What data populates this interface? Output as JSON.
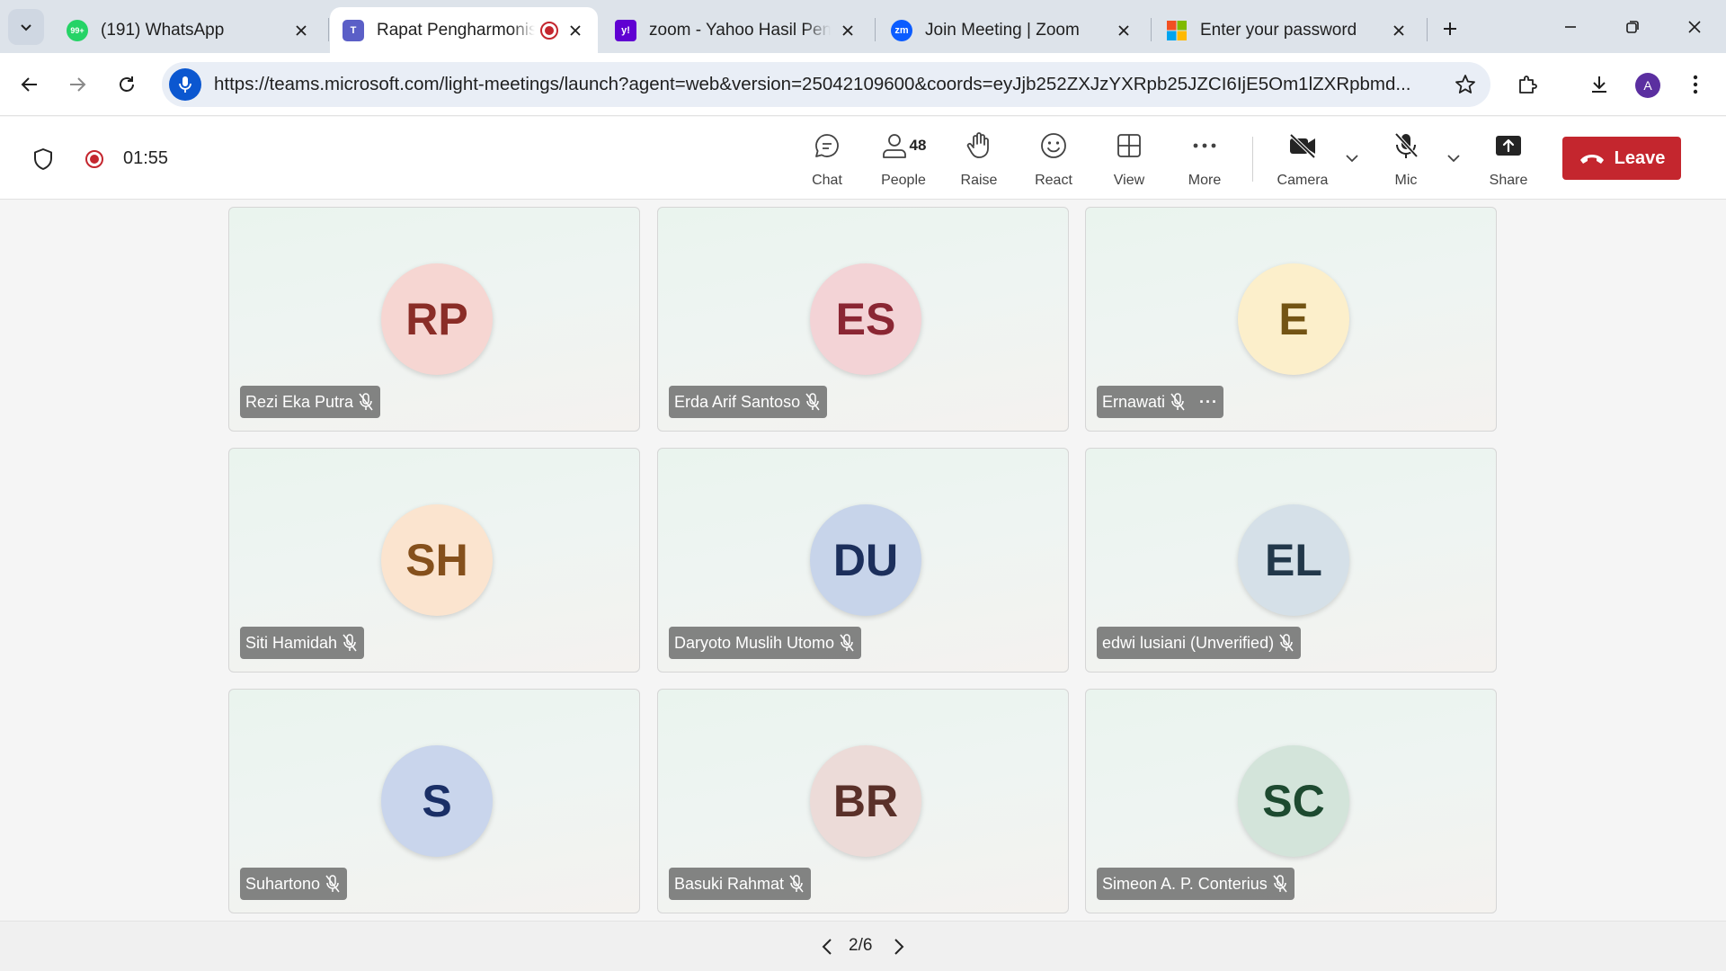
{
  "browser": {
    "tabs": [
      {
        "label": "(191) WhatsApp",
        "favicon": "whatsapp-icon",
        "favicon_badge": "99+",
        "active": false,
        "recording": false
      },
      {
        "label": "Rapat Pengharmonisasi",
        "favicon": "teams-icon",
        "active": true,
        "recording": true
      },
      {
        "label": "zoom - Yahoo Hasil Pencarian",
        "favicon": "yahoo-icon",
        "favicon_text": "y!",
        "active": false,
        "recording": false
      },
      {
        "label": "Join Meeting | Zoom",
        "favicon": "zoom-icon",
        "favicon_text": "zm",
        "active": false,
        "recording": false
      },
      {
        "label": "Enter your password",
        "favicon": "microsoft-icon",
        "active": false,
        "recording": false
      }
    ],
    "url": "https://teams.microsoft.com/light-meetings/launch?agent=web&version=25042109600&coords=eyJjb252ZXJzYXRpb25JZCI6IjE5Om1lZXRpbmd...",
    "profile_initial": "A"
  },
  "meeting": {
    "timer": "01:55",
    "controls": {
      "chat": "Chat",
      "people": "People",
      "people_count": "48",
      "raise": "Raise",
      "react": "React",
      "view": "View",
      "more": "More",
      "camera": "Camera",
      "mic": "Mic",
      "share": "Share",
      "leave": "Leave"
    },
    "participants": [
      {
        "initials": "RP",
        "name": "Rezi Eka Putra",
        "bg": "#f6d6d2",
        "fg": "#8a2d27",
        "more": false
      },
      {
        "initials": "ES",
        "name": "Erda Arif Santoso",
        "bg": "#f3d3d6",
        "fg": "#8a2633",
        "more": false
      },
      {
        "initials": "E",
        "name": "Ernawati",
        "bg": "#fcefcb",
        "fg": "#735414",
        "more": true,
        "more_label": "···"
      },
      {
        "initials": "SH",
        "name": "Siti Hamidah",
        "bg": "#fbe4cf",
        "fg": "#85501c",
        "more": false
      },
      {
        "initials": "DU",
        "name": "Daryoto Muslih Utomo",
        "bg": "#c7d4ea",
        "fg": "#1c2f5c",
        "more": false
      },
      {
        "initials": "EL",
        "name": "edwi lusiani (Unverified)",
        "bg": "#d5e0e8",
        "fg": "#22384a",
        "more": false
      },
      {
        "initials": "S",
        "name": "Suhartono",
        "bg": "#c9d5ec",
        "fg": "#1a2f66",
        "more": false
      },
      {
        "initials": "BR",
        "name": "Basuki Rahmat",
        "bg": "#ecdbd8",
        "fg": "#5a3029",
        "more": false
      },
      {
        "initials": "SC",
        "name": "Simeon A. P. Conterius",
        "bg": "#d3e4da",
        "fg": "#1d4a30",
        "more": false
      }
    ],
    "pagination": "2/6"
  },
  "colors": {
    "leave": "#c4262e",
    "recording": "#c4262e",
    "omnibox_mic": "#0b57d0"
  }
}
